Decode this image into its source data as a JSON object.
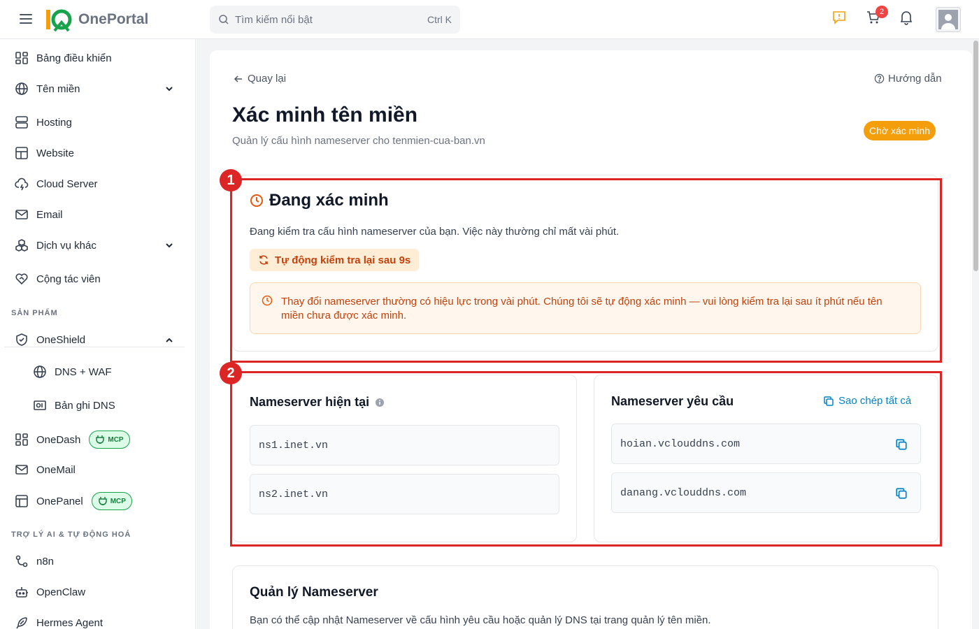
{
  "app": {
    "logo_text": "OnePortal",
    "logo_mark": "10"
  },
  "search": {
    "placeholder": "Tìm kiếm nổi bật",
    "shortcut": "Ctrl K"
  },
  "header": {
    "cart_count": "2"
  },
  "sidebar": {
    "items": [
      {
        "label": "Bảng điều khiển",
        "icon": "dashboard-icon"
      },
      {
        "label": "Tên miền",
        "icon": "globe-icon"
      },
      {
        "label": "Hosting",
        "icon": "server-icon"
      },
      {
        "label": "Website",
        "icon": "layout-icon"
      },
      {
        "label": "Cloud Server",
        "icon": "cloud-icon"
      },
      {
        "label": "Email",
        "icon": "mail-icon"
      },
      {
        "label": "Dịch vụ khác",
        "icon": "boxes-icon"
      },
      {
        "label": "Cộng tác viên",
        "icon": "heart-handshake-icon"
      }
    ],
    "section_products": "SẢN PHẨM",
    "products": [
      {
        "label": "OneShield",
        "icon": "shield-icon"
      },
      {
        "label": "DNS + WAF",
        "icon": "globe-icon"
      },
      {
        "label": "Bản ghi DNS",
        "icon": "dns-record-icon"
      },
      {
        "label": "OneDash",
        "icon": "dashboard-icon",
        "badge": "MCP"
      },
      {
        "label": "OneMail",
        "icon": "mail-icon"
      },
      {
        "label": "OnePanel",
        "icon": "panel-icon",
        "badge": "MCP"
      }
    ],
    "section_ai": "TRỢ LÝ AI & TỰ ĐỘNG HOÁ",
    "ai": [
      {
        "label": "n8n",
        "icon": "workflow-icon"
      },
      {
        "label": "OpenClaw",
        "icon": "bot-icon"
      },
      {
        "label": "Hermes Agent",
        "icon": "feather-icon"
      }
    ]
  },
  "page": {
    "back_label": "Quay lại",
    "guide_label": "Hướng dẫn",
    "title": "Xác minh tên miền",
    "subtitle": "Quản lý cấu hình nameserver cho tenmien-cua-ban.vn",
    "status": "Chờ xác minh"
  },
  "verify": {
    "title": "Đang xác minh",
    "desc": "Đang kiểm tra cấu hình nameserver của bạn. Việc này thường chỉ mất vài phút.",
    "auto_check": "Tự động kiểm tra lại sau 9s",
    "notice": "Thay đổi nameserver thường có hiệu lực trong vài phút. Chúng tôi sẽ tự động xác minh — vui lòng kiểm tra lại sau ít phút nếu tên miền chưa được xác minh."
  },
  "current_ns": {
    "title": "Nameserver hiện tại",
    "values": [
      "ns1.inet.vn",
      "ns2.inet.vn"
    ]
  },
  "required_ns": {
    "title": "Nameserver yêu cầu",
    "copy_all": "Sao chép tất cả",
    "values": [
      "hoian.vclouddns.com",
      "danang.vclouddns.com"
    ]
  },
  "management": {
    "title": "Quản lý Nameserver",
    "desc": "Bạn có thể cập nhật Nameserver về cấu hình yêu cầu hoặc quản lý DNS tại trang quản lý tên miền."
  },
  "annotations": [
    "1",
    "2"
  ],
  "colors": {
    "accent_orange": "#f59e0b",
    "annotation_red": "#dc2626",
    "link_blue": "#0284c7",
    "mcp_green": "#16a34a"
  }
}
